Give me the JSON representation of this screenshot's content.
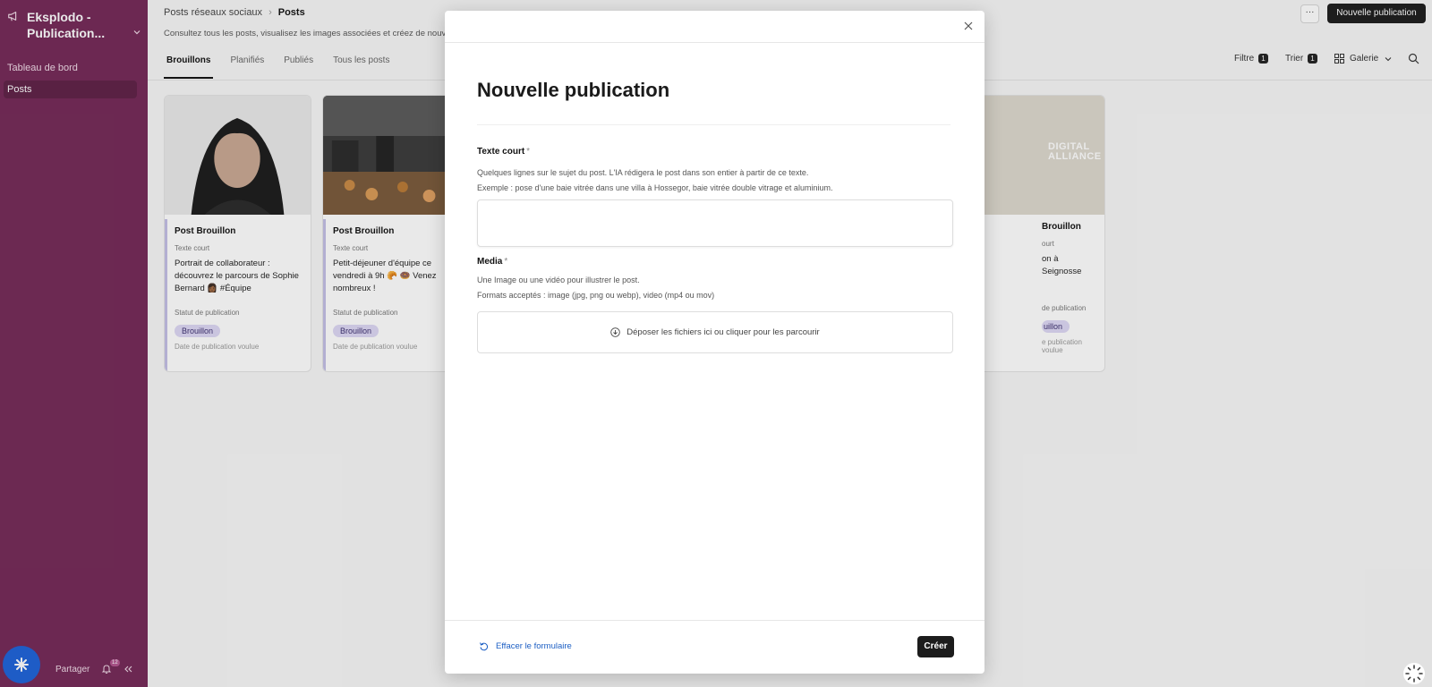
{
  "sidebar": {
    "app_title": "Eksplodo - Publication...",
    "items": [
      {
        "label": "Tableau de bord"
      },
      {
        "label": "Posts"
      }
    ],
    "share_label": "Partager",
    "notification_count": "12"
  },
  "header": {
    "breadcrumb_parent": "Posts réseaux sociaux",
    "breadcrumb_current": "Posts",
    "subtitle": "Consultez tous les posts, visualisez les images associées et créez de nouvea",
    "new_button": "Nouvelle publication",
    "more_label": "···"
  },
  "tabs": [
    {
      "label": "Brouillons"
    },
    {
      "label": "Planifiés"
    },
    {
      "label": "Publiés"
    },
    {
      "label": "Tous les posts"
    }
  ],
  "toolbar": {
    "filter_label": "Filtre",
    "filter_count": "1",
    "sort_label": "Trier",
    "sort_count": "1",
    "view_label": "Galerie"
  },
  "cards": [
    {
      "title": "Post Brouillon",
      "text_label": "Texte court",
      "text": "Portrait de collaborateur : découvrez le parcours de Sophie Bernard 👩🏾 #Équipe",
      "status_label": "Statut de publication",
      "status": "Brouillon",
      "date_label": "Date de publication voulue"
    },
    {
      "title": "Post Brouillon",
      "text_label": "Texte court",
      "text": "Petit-déjeuner d'équipe ce vendredi à 9h 🥐 🍩 Venez nombreux !",
      "status_label": "Statut de publication",
      "status": "Brouillon",
      "date_label": "Date de publication voulue"
    },
    {
      "title": "Brouillon",
      "text_label": "ourt",
      "text": "on à Seignosse",
      "status_label": "de publication",
      "status": "uillon",
      "date_label": "e publication voulue",
      "logo_line1": "DIGITAL",
      "logo_line2": "ALLIANCE"
    }
  ],
  "modal": {
    "title": "Nouvelle publication",
    "field1_label": "Texte court",
    "required_mark": "*",
    "field1_help1": "Quelques lignes sur le sujet du post. L'IA rédigera le post dans son entier à partir de ce texte.",
    "field1_help2": "Exemple : pose d'une baie vitrée dans une villa à Hossegor, baie vitrée double vitrage et aluminium.",
    "field2_label": "Media",
    "field2_help1": "Une Image ou une vidéo pour illustrer le post.",
    "field2_help2": "Formats acceptés : image (jpg, png ou webp), video (mp4 ou mov)",
    "dropzone_text": "Déposer les fichiers ici ou cliquer pour les parcourir",
    "reset_label": "Effacer le formulaire",
    "create_label": "Créer"
  },
  "colors": {
    "sidebar_bg": "#742957",
    "accent_blue": "#1d63d8",
    "status_badge": "#ddd7f4",
    "primary_button": "#1c1c1c"
  },
  "icons": [
    "megaphone-icon",
    "chevron-down-icon",
    "assistant-icon",
    "bell-icon",
    "collapse-icon",
    "grid-icon",
    "search-icon",
    "close-icon",
    "upload-icon",
    "reset-icon",
    "loader-icon"
  ]
}
